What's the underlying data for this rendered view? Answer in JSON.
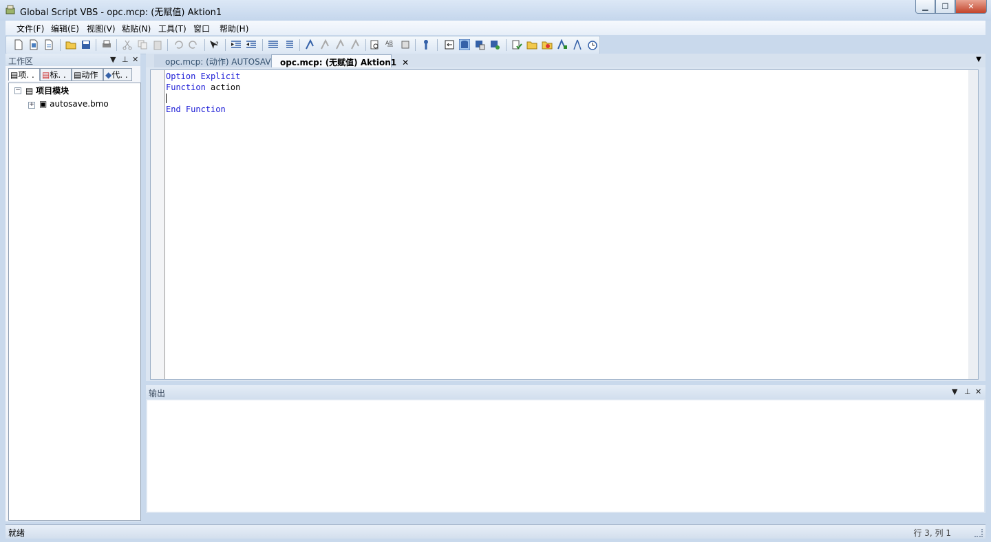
{
  "window": {
    "title": "Global Script VBS - opc.mcp: (无赋值) Aktion1"
  },
  "menu": [
    "文件(F)",
    "编辑(E)",
    "视图(V)",
    "粘贴(N)",
    "工具(T)",
    "窗口",
    "帮助(H)"
  ],
  "workspace": {
    "title": "工作区",
    "tabs": [
      "项. .",
      "标. .",
      "动作",
      "代. ."
    ],
    "tree": {
      "root": "项目模块",
      "child": "autosave.bmo"
    }
  },
  "editor": {
    "tabs": [
      {
        "label": "opc.mcp: (动作) AUTOSAVE"
      },
      {
        "label": "opc.mcp: (无赋值) Aktion1"
      }
    ],
    "lines": {
      "l1_kw": "Option Explicit",
      "l2_kw": "Function",
      "l2_rest": " action",
      "l4_kw": "End Function"
    }
  },
  "output": {
    "title": "输出"
  },
  "status": {
    "left": "就绪",
    "right": "行 3, 列 1"
  },
  "colors": {
    "keyword": "#1a1ad6",
    "close": "#c2432a"
  }
}
